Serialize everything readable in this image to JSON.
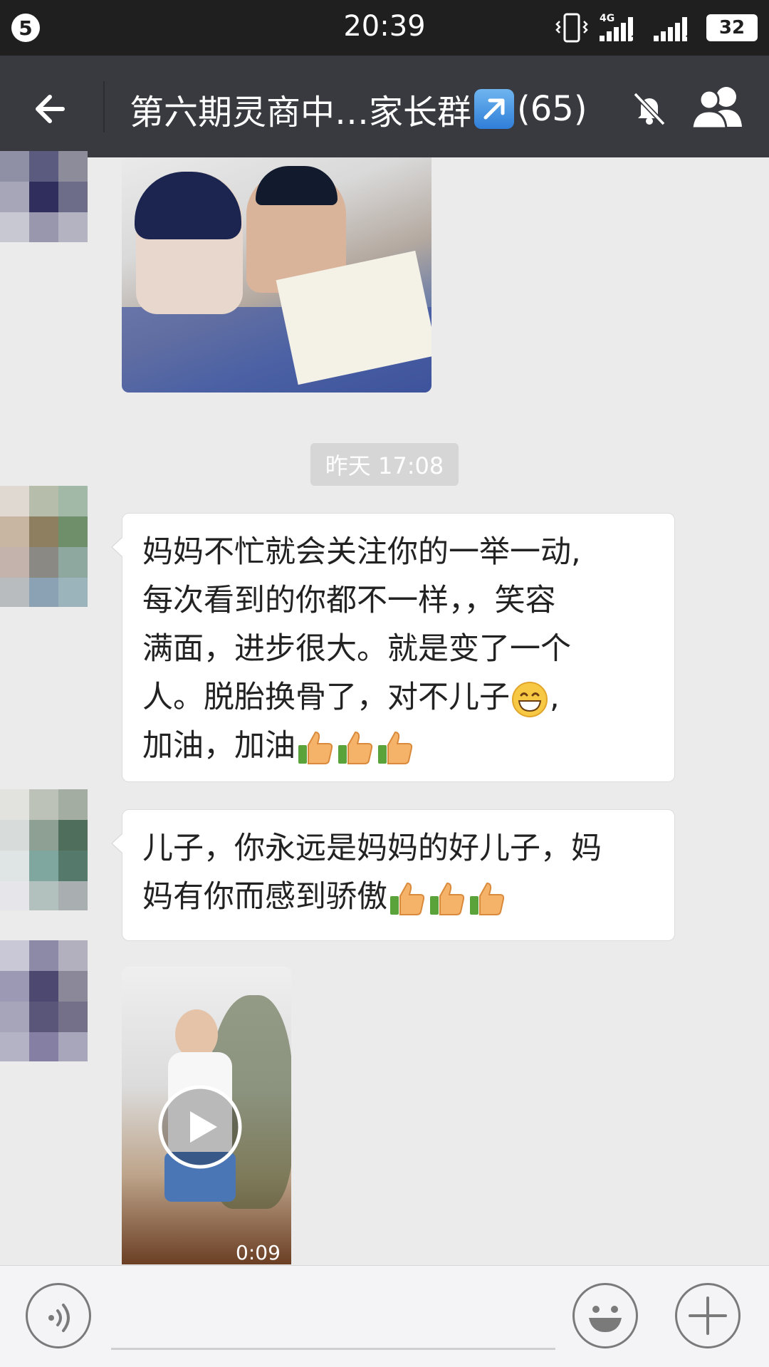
{
  "status_bar": {
    "notification_count": "5",
    "time": "20:39",
    "network": "4G",
    "sim1": "2",
    "sim2": "1",
    "battery": "32"
  },
  "header": {
    "title": "第六期灵商中…家长群",
    "member_count": "(65)",
    "icons": [
      "back-arrow-icon",
      "share-arrow-icon",
      "mute-bell-icon",
      "group-members-icon"
    ]
  },
  "messages": [
    {
      "type": "image",
      "sender": "avatar-1"
    },
    {
      "type": "timestamp",
      "text": "昨天 17:08"
    },
    {
      "type": "text",
      "sender": "avatar-2",
      "lines": [
        "妈妈不忙就会关注你的一举一动,",
        "每次看到的你都不一样，，笑容",
        "满面，进步很大。就是变了一个",
        "人。脱胎换骨了，对不儿子",
        "加油，加油"
      ],
      "emojis": [
        "grin-emoji",
        "thumbs-up-emoji"
      ]
    },
    {
      "type": "text",
      "sender": "avatar-3",
      "lines": [
        "儿子，你永远是妈妈的好儿子，妈",
        "妈有你而感到骄傲"
      ],
      "emojis": [
        "thumbs-up-emoji"
      ]
    },
    {
      "type": "video",
      "sender": "avatar-4",
      "duration": "0:09"
    }
  ],
  "input_bar": {
    "icons": [
      "voice-icon",
      "emoji-face-icon",
      "plus-icon"
    ]
  },
  "colors": {
    "status_bar_bg": "#1f1f20",
    "title_bar_bg": "#393a3f",
    "chat_bg": "#ebebeb",
    "bubble_bg": "#ffffff",
    "timestamp_bg": "#d6d6d6"
  }
}
